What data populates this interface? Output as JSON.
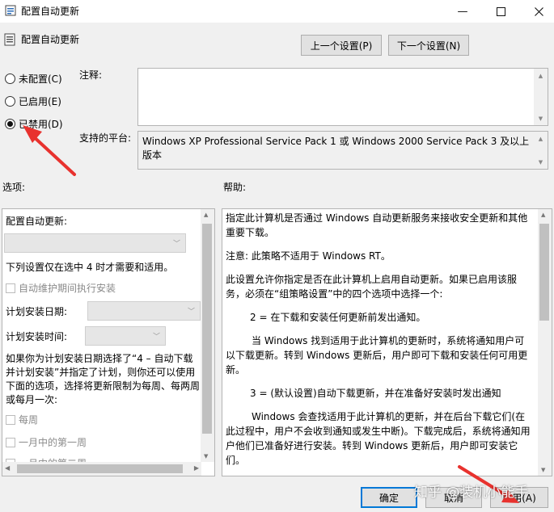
{
  "window": {
    "title": "配置自动更新"
  },
  "header": {
    "title": "配置自动更新",
    "prev_label": "上一个设置(P)",
    "next_label": "下一个设置(N)"
  },
  "state": {
    "radios": [
      {
        "label": "未配置(C)",
        "checked": false
      },
      {
        "label": "已启用(E)",
        "checked": false
      },
      {
        "label": "已禁用(D)",
        "checked": true
      }
    ]
  },
  "comment": {
    "label": "注释:",
    "value": ""
  },
  "platform": {
    "label": "支持的平台:",
    "value": "Windows XP Professional Service Pack 1 或 Windows 2000 Service Pack 3 及以上版本"
  },
  "options": {
    "title": "选项:",
    "configure_label": "配置自动更新:",
    "note": "下列设置仅在选中 4 时才需要和适用。",
    "maintenance_checkbox": "自动维护期间执行安装",
    "day_label": "计划安装日期:",
    "time_label": "计划安装时间:",
    "paragraph": "如果你为计划安装日期选择了“4 – 自动下载并计划安装”并指定了计划，则你还可以使用下面的选项，选择将更新限制为每周、每两周或每月一次:",
    "weekly": "每周",
    "first_week": "一月中的第一周",
    "second_week": "一月中的第二周"
  },
  "help": {
    "title": "帮助:",
    "paragraphs": [
      "指定此计算机是否通过 Windows 自动更新服务来接收安全更新和其他重要下载。",
      "注意: 此策略不适用于 Windows RT。",
      "此设置允许你指定是否在此计算机上启用自动更新。如果已启用该服务，必须在“组策略设置”中的四个选项中选择一个:",
      "2 = 在下载和安装任何更新前发出通知。",
      "当 Windows 找到适用于此计算机的更新时，系统将通知用户可以下载更新。转到 Windows 更新后，用户即可下载和安装任何可用更新。",
      "3 = (默认设置)自动下载更新，并在准备好安装时发出通知",
      "Windows 会查找适用于此计算机的更新，并在后台下载它们(在此过程中，用户不会收到通知或发生中断)。下载完成后，系统将通知用户他们已准备好进行安装。转到 Windows 更新后，用户即可安装它们。"
    ]
  },
  "footer": {
    "ok": "确定",
    "cancel": "取消",
    "apply": "应用(A)"
  },
  "watermark": "知乎 @装机小能手",
  "colors": {
    "annotation_arrow": "#e8322e",
    "accent": "#0078d7"
  }
}
